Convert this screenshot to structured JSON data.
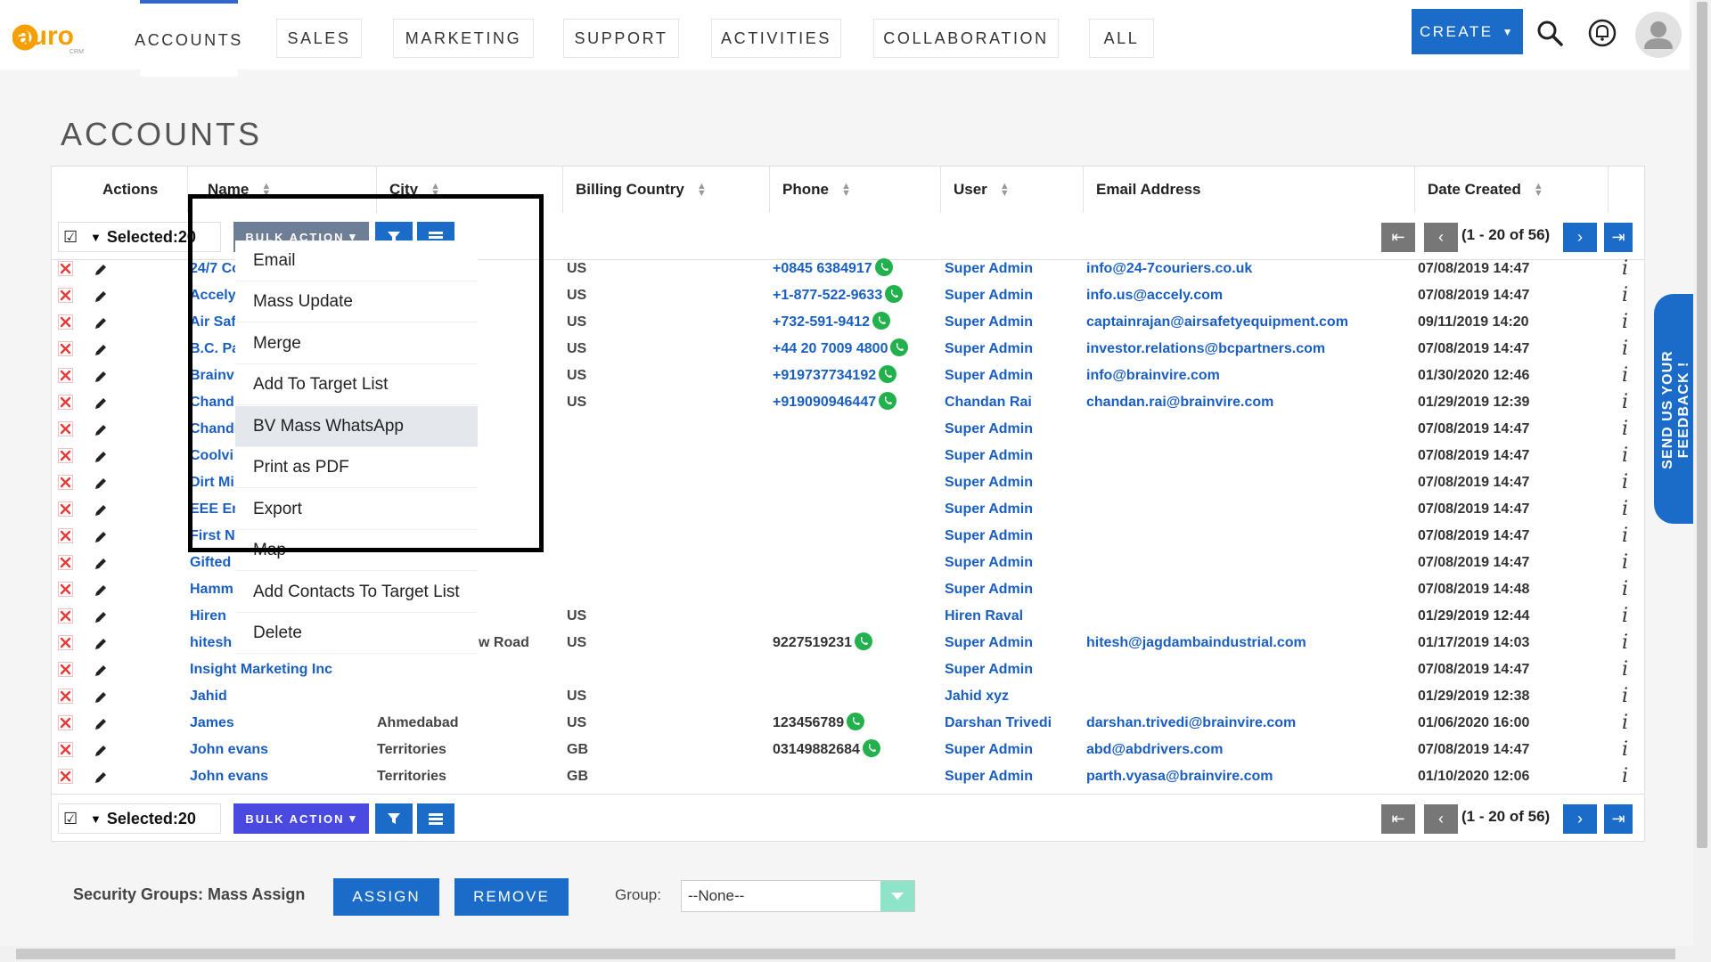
{
  "nav": {
    "logo_text": "auro",
    "logo_sub": "CRM",
    "tabs": [
      "ACCOUNTS",
      "SALES",
      "MARKETING",
      "SUPPORT",
      "ACTIVITIES",
      "COLLABORATION",
      "ALL"
    ],
    "create_label": "CREATE"
  },
  "page_title": "ACCOUNTS",
  "table": {
    "headers": {
      "actions": "Actions",
      "name": "Name",
      "city": "City",
      "country": "Billing Country",
      "phone": "Phone",
      "user": "User",
      "email": "Email Address",
      "date": "Date Created"
    },
    "selected_label": "Selected:20",
    "bulk_action_label": "BULK ACTION",
    "pagination_text": "(1 - 20 of 56)",
    "info_glyph": "i",
    "rows": [
      {
        "name": "24/7 Co",
        "city": "",
        "country": "US",
        "phone": "+0845 6384917",
        "user": "Super Admin",
        "email": "info@24-7couriers.co.uk",
        "date": "07/08/2019 14:47"
      },
      {
        "name": "Accely",
        "city": "",
        "country": "US",
        "phone": "+1-877-522-9633",
        "user": "Super Admin",
        "email": "info.us@accely.com",
        "date": "07/08/2019 14:47"
      },
      {
        "name": "Air Saf",
        "city": "",
        "country": "US",
        "phone": "+732-591-9412",
        "user": "Super Admin",
        "email": "captainrajan@airsafetyequipment.com",
        "date": "09/11/2019 14:20"
      },
      {
        "name": "B.C. Pa",
        "city": "",
        "country": "US",
        "phone": "+44 20 7009 4800",
        "user": "Super Admin",
        "email": "investor.relations@bcpartners.com",
        "date": "07/08/2019 14:47"
      },
      {
        "name": "Brainv",
        "city": "",
        "country": "US",
        "phone": "+919737734192",
        "user": "Super Admin",
        "email": "info@brainvire.com",
        "date": "01/30/2020 12:46"
      },
      {
        "name": "Chand",
        "city": "",
        "country": "US",
        "phone": "+919090946447",
        "user": "Chandan Rai",
        "email": "chandan.rai@brainvire.com",
        "date": "01/29/2019 12:39"
      },
      {
        "name": "Chandi",
        "city": "",
        "country": "",
        "phone": "",
        "user": "Super Admin",
        "email": "",
        "date": "07/08/2019 14:47"
      },
      {
        "name": "Coolvi",
        "city": "",
        "country": "",
        "phone": "",
        "user": "Super Admin",
        "email": "",
        "date": "07/08/2019 14:47"
      },
      {
        "name": "Dirt Mi",
        "city": "",
        "country": "",
        "phone": "",
        "user": "Super Admin",
        "email": "",
        "date": "07/08/2019 14:47"
      },
      {
        "name": "EEE En",
        "city": "",
        "country": "",
        "phone": "",
        "user": "Super Admin",
        "email": "",
        "date": "07/08/2019 14:47"
      },
      {
        "name": "First N",
        "city": "",
        "country": "",
        "phone": "",
        "user": "Super Admin",
        "email": "",
        "date": "07/08/2019 14:47"
      },
      {
        "name": "Gifted",
        "city": "",
        "country": "",
        "phone": "",
        "user": "Super Admin",
        "email": "",
        "date": "07/08/2019 14:47"
      },
      {
        "name": "Hamm",
        "city": "",
        "country": "",
        "phone": "",
        "user": "Super Admin",
        "email": "",
        "date": "07/08/2019 14:48"
      },
      {
        "name": "Hiren",
        "city": "",
        "country": "US",
        "phone": "",
        "user": "Hiren Raval",
        "email": "",
        "date": "01/29/2019 12:44"
      },
      {
        "name": "hitesh",
        "city": "w Road",
        "country": "US",
        "phone": "9227519231",
        "user": "Super Admin",
        "email": "hitesh@jagdambaindustrial.com",
        "date": "01/17/2019 14:03"
      },
      {
        "name": "Insight Marketing Inc",
        "city": "",
        "country": "",
        "phone": "",
        "user": "Super Admin",
        "email": "",
        "date": "07/08/2019 14:47"
      },
      {
        "name": "Jahid",
        "city": "",
        "country": "US",
        "phone": "",
        "user": "Jahid xyz",
        "email": "",
        "date": "01/29/2019 12:38"
      },
      {
        "name": "James",
        "city": "Ahmedabad",
        "country": "US",
        "phone": "123456789",
        "user": "Darshan Trivedi",
        "email": "darshan.trivedi@brainvire.com",
        "date": "01/06/2020 16:00"
      },
      {
        "name": "John evans",
        "city": "Territories",
        "country": "GB",
        "phone": "03149882684",
        "user": "Super Admin",
        "email": "abd@abdrivers.com",
        "date": "07/08/2019 14:47"
      },
      {
        "name": "John evans",
        "city": "Territories",
        "country": "GB",
        "phone": "",
        "user": "Super Admin",
        "email": "parth.vyasa@brainvire.com",
        "date": "01/10/2020 12:06"
      }
    ]
  },
  "bulk_menu": {
    "items": [
      "Email",
      "Mass Update",
      "Merge",
      "Add To Target List",
      "BV Mass WhatsApp",
      "Print as PDF",
      "Export",
      "Map",
      "Add Contacts To Target List",
      "Delete"
    ],
    "highlighted": "BV Mass WhatsApp"
  },
  "feedback_label": "SEND US YOUR FEEDBACK !",
  "security": {
    "label": "Security Groups: Mass Assign",
    "assign_label": "ASSIGN",
    "remove_label": "REMOVE",
    "group_label": "Group:",
    "group_value": "--None--"
  },
  "colors": {
    "accent": "#1a6cc8",
    "bulk": "#4a4ae0",
    "link": "#1a5fc0",
    "whatsapp": "#22b14c",
    "logo": "#f5a000"
  }
}
